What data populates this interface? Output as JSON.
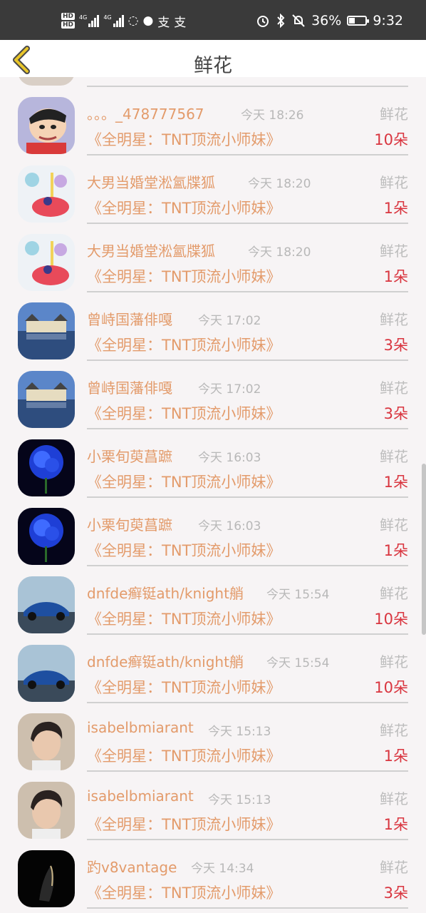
{
  "status_bar": {
    "hd1": "HD",
    "hd2": "HD",
    "net1": "4G",
    "net2": "4G",
    "battery_pct": "36%",
    "battery_level": 0.36,
    "time": "9:32",
    "icons": [
      "alarm-icon",
      "bluetooth-icon",
      "mute-bell-icon"
    ]
  },
  "header": {
    "title": "鲜花",
    "back_icon": "chevron-left-icon",
    "accent": "#e8c52a"
  },
  "records": [
    {
      "name": "。。。_478777567",
      "time": "今天 18:26",
      "gift": "鲜花",
      "room": "《全明星：TNT顶流小师妹》",
      "count": "10朵",
      "avatar": "cartoon-boy"
    },
    {
      "name": "大男当婚堂淞氳牒狐",
      "time": "今天 18:20",
      "gift": "鲜花",
      "room": "《全明星：TNT顶流小师妹》",
      "count": "1朵",
      "avatar": "birthday-cake"
    },
    {
      "name": "大男当婚堂淞氳牒狐",
      "time": "今天 18:20",
      "gift": "鲜花",
      "room": "《全明星：TNT顶流小师妹》",
      "count": "1朵",
      "avatar": "birthday-cake"
    },
    {
      "name": "曾峙国藩俳嘎",
      "time": "今天 17:02",
      "gift": "鲜花",
      "room": "《全明星：TNT顶流小师妹》",
      "count": "3朵",
      "avatar": "castle-lake"
    },
    {
      "name": "曾峙国藩俳嘎",
      "time": "今天 17:02",
      "gift": "鲜花",
      "room": "《全明星：TNT顶流小师妹》",
      "count": "3朵",
      "avatar": "castle-lake"
    },
    {
      "name": "小栗旬萸菖蹠",
      "time": "今天 16:03",
      "gift": "鲜花",
      "room": "《全明星：TNT顶流小师妹》",
      "count": "1朵",
      "avatar": "blue-rose"
    },
    {
      "name": "小栗旬萸菖蹠",
      "time": "今天 16:03",
      "gift": "鲜花",
      "room": "《全明星：TNT顶流小师妹》",
      "count": "1朵",
      "avatar": "blue-rose"
    },
    {
      "name": "dnfde癣铤ath/knight艄",
      "time": "今天 15:54",
      "gift": "鲜花",
      "room": "《全明星：TNT顶流小师妹》",
      "count": "10朵",
      "avatar": "blue-car"
    },
    {
      "name": "dnfde癣铤ath/knight艄",
      "time": "今天 15:54",
      "gift": "鲜花",
      "room": "《全明星：TNT顶流小师妹》",
      "count": "10朵",
      "avatar": "blue-car"
    },
    {
      "name": "isabelbmiarant",
      "time": "今天 15:13",
      "gift": "鲜花",
      "room": "《全明星：TNT顶流小师妹》",
      "count": "1朵",
      "avatar": "portrait"
    },
    {
      "name": "isabelbmiarant",
      "time": "今天 15:13",
      "gift": "鲜花",
      "room": "《全明星：TNT顶流小师妹》",
      "count": "1朵",
      "avatar": "portrait"
    },
    {
      "name": "趵v8vantage",
      "time": "今天 14:34",
      "gift": "鲜花",
      "room": "《全明星：TNT顶流小师妹》",
      "count": "3朵",
      "avatar": "dark-silhouette"
    }
  ]
}
